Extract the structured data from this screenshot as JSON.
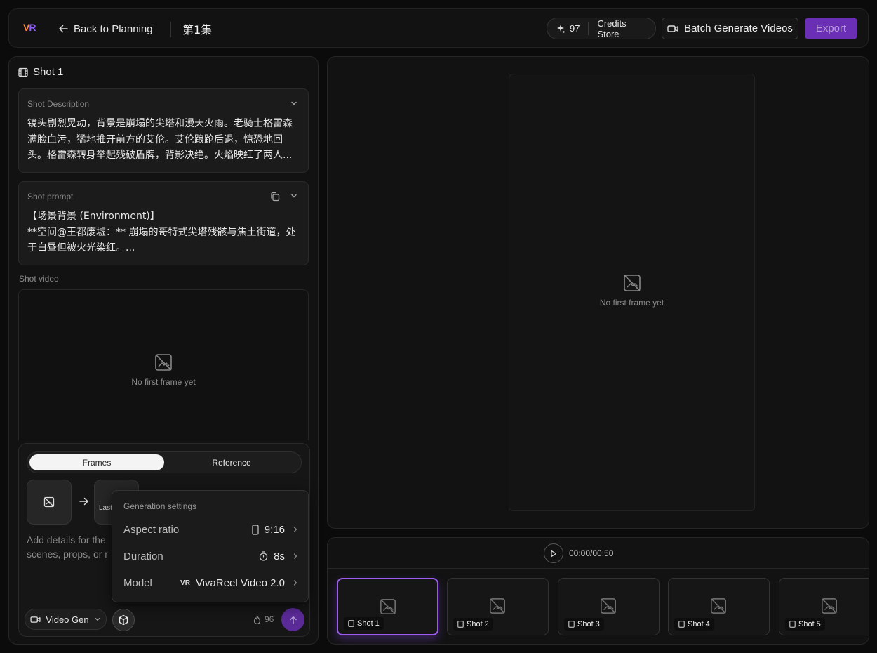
{
  "header": {
    "back_label": "Back to Planning",
    "episode_title": "第1集",
    "credits_count": "97",
    "credits_store_label": "Credits Store",
    "batch_label": "Batch Generate Videos",
    "export_label": "Export"
  },
  "left": {
    "shot_title": "Shot 1",
    "description": {
      "label": "Shot Description",
      "text": "镜头剧烈晃动，背景是崩塌的尖塔和漫天火雨。老骑士格雷森满脸血污，猛地推开前方的艾伦。艾伦踉跄后退，惊恐地回头。格雷森转身举起残破盾牌，背影决绝。火焰映红了两人..."
    },
    "prompt": {
      "label": "Shot prompt",
      "text": "【场景背景 (Environment)】\n**空间@王都废墟：** 崩塌的哥特式尖塔残骸与焦土街道，处于白昼但被火光染红。..."
    },
    "video_label": "Shot video",
    "video_empty": "No first frame yet"
  },
  "composer": {
    "tabs": [
      "Frames",
      "Reference"
    ],
    "active_tab": "Frames",
    "last_frame_label": "Last",
    "placeholder_line1": "Add details for the",
    "placeholder_line2": "scenes, props, or r",
    "mode_label": "Video Gen",
    "cost": "96"
  },
  "settings": {
    "title": "Generation settings",
    "aspect_label": "Aspect ratio",
    "aspect_value": "9:16",
    "duration_label": "Duration",
    "duration_value": "8s",
    "model_label": "Model",
    "model_value": "VivaReel Video 2.0"
  },
  "preview": {
    "empty_text": "No first frame yet"
  },
  "timeline": {
    "time": "00:00/00:50",
    "shots": [
      "Shot 1",
      "Shot 2",
      "Shot 3",
      "Shot 4",
      "Shot 5"
    ],
    "active_index": 0
  },
  "colors": {
    "accent": "#6b2fb5",
    "active_border": "#9b5cf0",
    "logo_v": "#ff8a3d",
    "logo_r": "#8e5bff"
  }
}
